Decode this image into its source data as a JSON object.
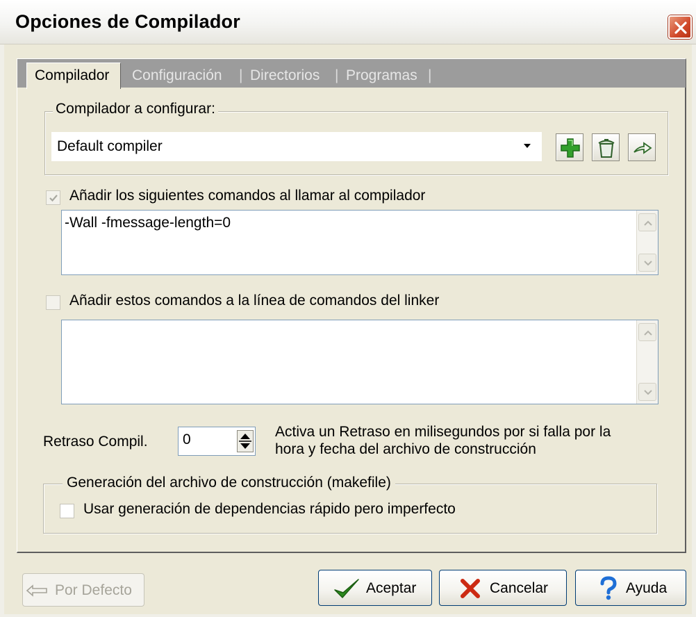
{
  "window": {
    "title": "Opciones de Compilador"
  },
  "tabs": [
    {
      "label": "Compilador",
      "active": true
    },
    {
      "label": "Configuración",
      "active": false
    },
    {
      "label": "Directorios",
      "active": false
    },
    {
      "label": "Programas",
      "active": false
    }
  ],
  "tab_separator": "|",
  "compiler_group": {
    "label": "Compilador a configurar:",
    "selected": "Default compiler"
  },
  "compiler_commands": {
    "label": "Añadir los siguientes comandos al llamar al compilador",
    "checked": true,
    "value": "-Wall -fmessage-length=0"
  },
  "linker_commands": {
    "label": "Añadir estos comandos a la línea de comandos del linker",
    "checked": false,
    "value": ""
  },
  "delay": {
    "label": "Retraso Compil.",
    "value": "0",
    "description_line1": "Activa un Retraso en milisegundos por si falla por la",
    "description_line2": "hora y fecha del archivo de construcción"
  },
  "makefile_group": {
    "label": "Generación del archivo de construcción (makefile)",
    "fast_deps_label": "Usar generación de dependencias rápido pero imperfecto",
    "fast_deps_checked": false
  },
  "buttons": {
    "default": "Por Defecto",
    "ok": "Aceptar",
    "cancel": "Cancelar",
    "help": "Ayuda"
  },
  "icons": {
    "close": "close-icon",
    "add": "plus-icon",
    "delete": "trash-icon",
    "rename": "arrow-right-icon",
    "ok": "check-icon",
    "cancel": "x-icon",
    "help": "question-icon",
    "default": "arrow-left-icon"
  },
  "colors": {
    "window_bg": "#ece9d8",
    "tabstrip_bg": "#9c9c9c",
    "close_button": "#d1492a",
    "ok_check": "#2c8a1e",
    "cancel_x": "#cc2a12",
    "help_question": "#1f6fd6",
    "add_plus": "#33a02c"
  }
}
